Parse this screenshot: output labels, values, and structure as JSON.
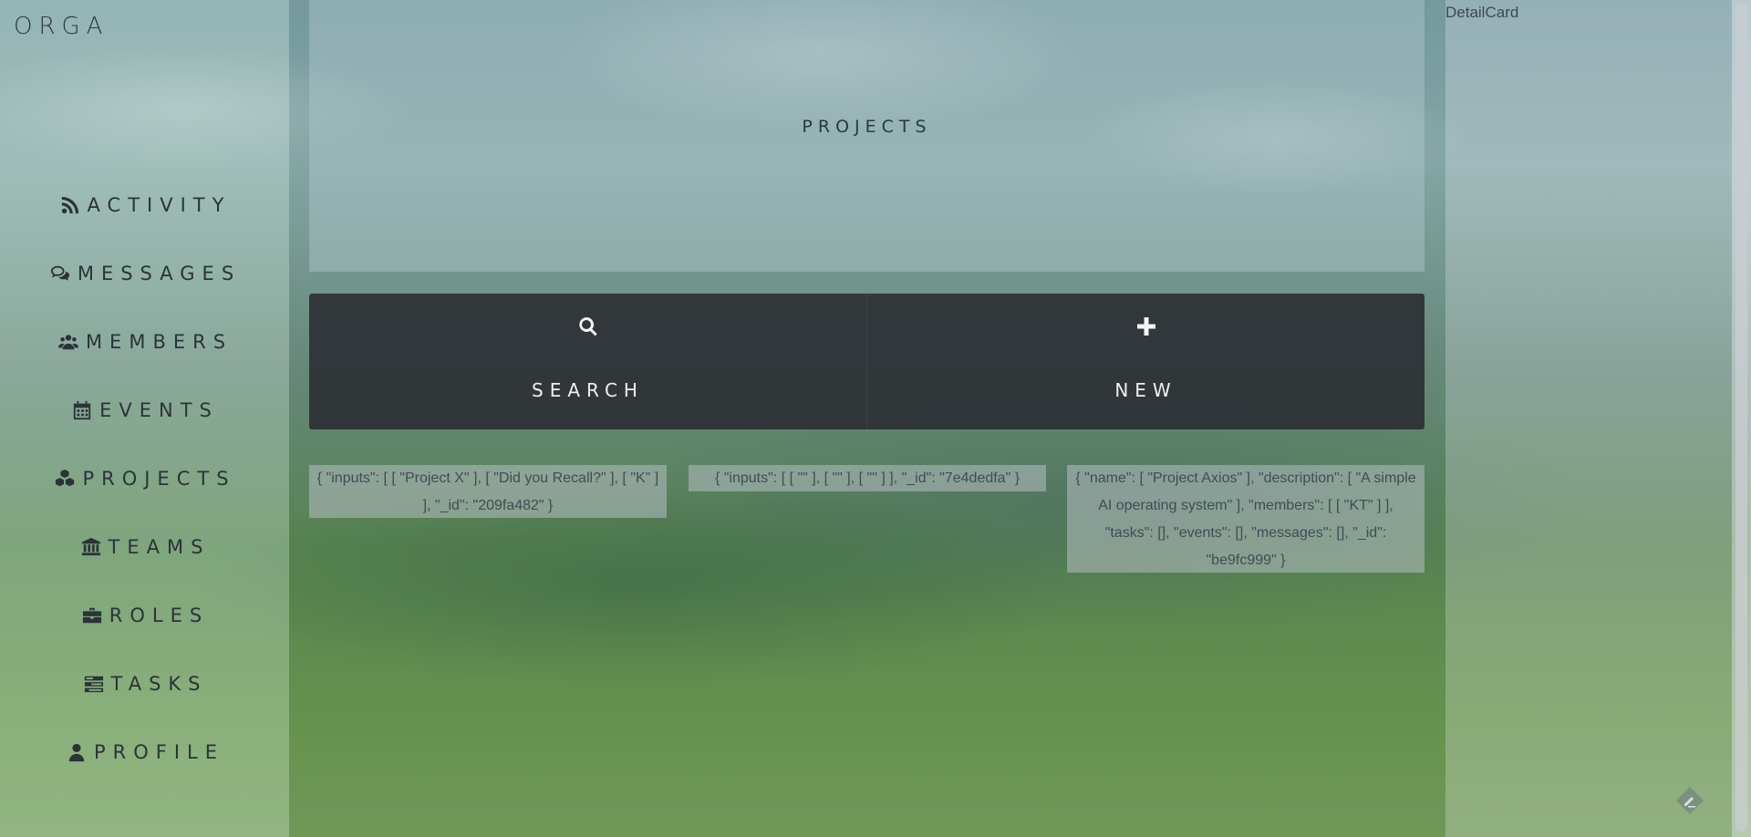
{
  "app": {
    "brand": "ORGA"
  },
  "sidebar": {
    "items": [
      {
        "label": "ACTIVITY",
        "icon": "rss-icon"
      },
      {
        "label": "MESSAGES",
        "icon": "comments-icon"
      },
      {
        "label": "MEMBERS",
        "icon": "users-icon"
      },
      {
        "label": "EVENTS",
        "icon": "calendar-icon"
      },
      {
        "label": "PROJECTS",
        "icon": "cubes-icon"
      },
      {
        "label": "TEAMS",
        "icon": "bank-icon"
      },
      {
        "label": "ROLES",
        "icon": "briefcase-icon"
      },
      {
        "label": "TASKS",
        "icon": "tasks-icon"
      },
      {
        "label": "PROFILE",
        "icon": "user-icon"
      }
    ]
  },
  "main": {
    "header": {
      "title": "PROJECTS"
    },
    "actions": [
      {
        "label": "SEARCH",
        "icon": "search-icon"
      },
      {
        "label": "NEW",
        "icon": "plus-icon"
      }
    ],
    "cards": [
      {
        "text": "{ \"inputs\": [ [ \"Project X\" ], [ \"Did you Recall?\" ], [ \"K\" ] ], \"_id\": \"209fa482\" }"
      },
      {
        "text": "{ \"inputs\": [ [ \"\" ], [ \"\" ], [ \"\" ] ], \"_id\": \"7e4dedfa\" }"
      },
      {
        "text": "{ \"name\": [ \"Project Axios\" ], \"description\": [ \"A simple AI operating system\" ], \"members\": [ [ \"KT\" ] ], \"tasks\": [], \"events\": [], \"messages\": [], \"_id\": \"be9fc999\" }"
      }
    ]
  },
  "detail": {
    "label": "DetailCard",
    "feedback_icon": "feedback-icon"
  }
}
